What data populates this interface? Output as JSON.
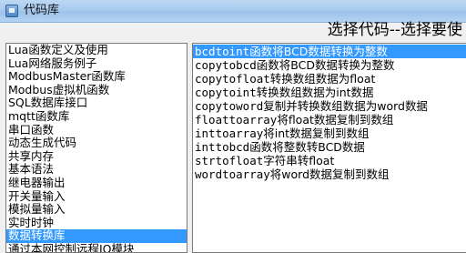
{
  "window": {
    "title": "代码库",
    "icon": "app-icon"
  },
  "header": {
    "prompt": "选择代码--选择要使"
  },
  "categories": [
    {
      "label": "Lua函数定义及使用"
    },
    {
      "label": "Lua网络服务例子"
    },
    {
      "label": "ModbusMaster函数库"
    },
    {
      "label": "Modbus虚拟机函数"
    },
    {
      "label": "SQL数据库接口"
    },
    {
      "label": "mqtt函数库"
    },
    {
      "label": "串口函数"
    },
    {
      "label": "动态生成代码"
    },
    {
      "label": "共享内存"
    },
    {
      "label": "基本语法"
    },
    {
      "label": "继电器输出"
    },
    {
      "label": "开关量输入"
    },
    {
      "label": "模拟量输入"
    },
    {
      "label": "实时时钟"
    },
    {
      "label": "数据转换库",
      "selected": true
    },
    {
      "label": "通过本网控制远程IO模块"
    }
  ],
  "functions": [
    {
      "code": "bcdtoint",
      "desc": "函数将BCD数据转换为整数",
      "selected": true
    },
    {
      "code": "copytobcd",
      "desc": "函数将BCD数据转换为整数"
    },
    {
      "code": "copytofloat",
      "desc": "转换数组数据为float"
    },
    {
      "code": "copytoint",
      "desc": "转换数组数据为int数据"
    },
    {
      "code": "copytoword",
      "desc": "复制并转换数组数据为word数据"
    },
    {
      "code": "floattoarray",
      "desc": "将float数据复制到数组"
    },
    {
      "code": "inttoarray",
      "desc": "将int数据复制到数组"
    },
    {
      "code": "inttobcd",
      "desc": "函数将整数转BCD数据"
    },
    {
      "code": "strtofloat",
      "desc": "字符串转float"
    },
    {
      "code": "wordtoarray",
      "desc": "将word数据复制到数组"
    }
  ]
}
